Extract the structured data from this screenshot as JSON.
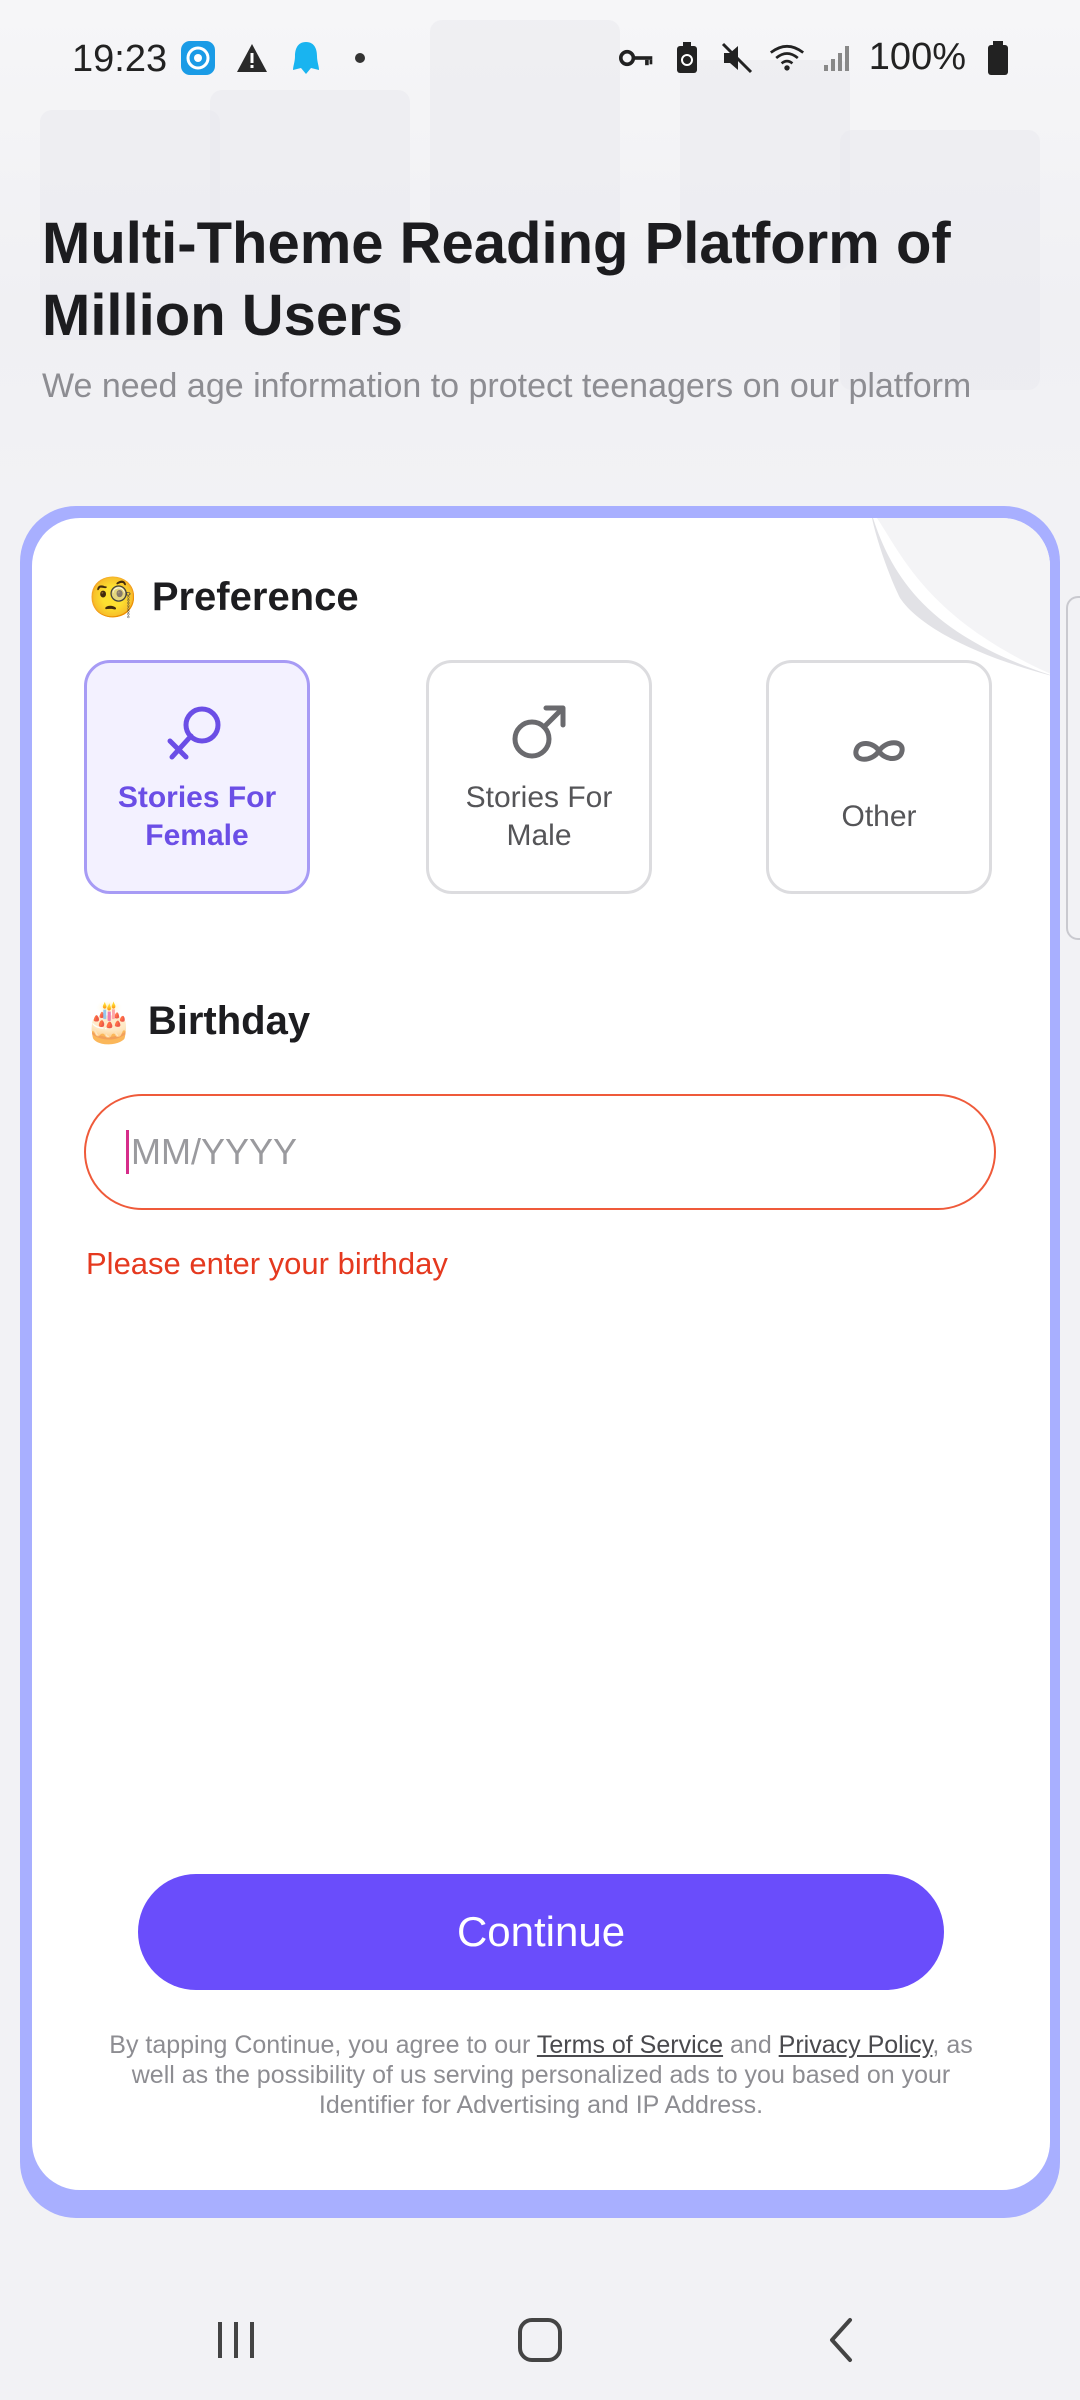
{
  "status_bar": {
    "time": "19:23",
    "battery_percent": "100%"
  },
  "header": {
    "title": "Multi-Theme Reading Platform of Million Users",
    "subtitle": "We need age information to protect teenagers on our platform"
  },
  "preference": {
    "emoji": "🧐",
    "title": "Preference",
    "options": [
      {
        "label": "Stories For Female",
        "icon": "female-icon",
        "selected": true
      },
      {
        "label": "Stories For Male",
        "icon": "male-icon",
        "selected": false
      },
      {
        "label": "Other",
        "icon": "infinity-icon",
        "selected": false
      }
    ]
  },
  "birthday": {
    "emoji": "🎂",
    "title": "Birthday",
    "placeholder": "MM/YYYY",
    "value": "",
    "error": "Please enter your birthday"
  },
  "continue_label": "Continue",
  "legal": {
    "part1": "By tapping Continue, you agree to our ",
    "terms": "Terms of Service",
    "part2": " and ",
    "privacy": "Privacy Policy",
    "part3": ", as well as the possibility of us serving personalized ads to you based on your Identifier for Advertising and IP Address."
  },
  "colors": {
    "accent": "#6a4dfb",
    "error": "#e5391f",
    "card_border": "#a8afff"
  }
}
